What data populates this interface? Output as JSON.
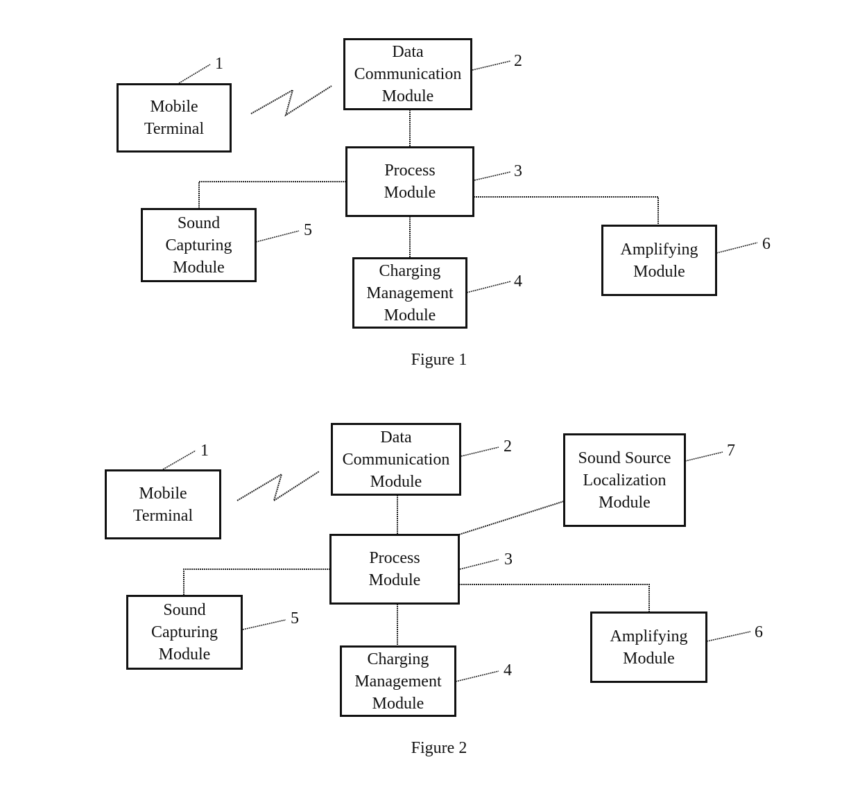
{
  "figures": [
    {
      "caption": "Figure 1",
      "modules": {
        "mobile_terminal": {
          "label": "Mobile\nTerminal",
          "ref": "1"
        },
        "data_communication": {
          "label": "Data\nCommunication\nModule",
          "ref": "2"
        },
        "process": {
          "label": "Process\nModule",
          "ref": "3"
        },
        "charging_management": {
          "label": "Charging\nManagement\nModule",
          "ref": "4"
        },
        "sound_capturing": {
          "label": "Sound\nCapturing\nModule",
          "ref": "5"
        },
        "amplifying": {
          "label": "Amplifying\nModule",
          "ref": "6"
        }
      },
      "connections": [
        [
          "mobile_terminal",
          "data_communication",
          "wireless"
        ],
        [
          "data_communication",
          "process",
          "wired"
        ],
        [
          "process",
          "sound_capturing",
          "wired"
        ],
        [
          "process",
          "charging_management",
          "wired"
        ],
        [
          "process",
          "amplifying",
          "wired"
        ]
      ]
    },
    {
      "caption": "Figure 2",
      "modules": {
        "mobile_terminal": {
          "label": "Mobile\nTerminal",
          "ref": "1"
        },
        "data_communication": {
          "label": "Data\nCommunication\nModule",
          "ref": "2"
        },
        "process": {
          "label": "Process\nModule",
          "ref": "3"
        },
        "charging_management": {
          "label": "Charging\nManagement\nModule",
          "ref": "4"
        },
        "sound_capturing": {
          "label": "Sound\nCapturing\nModule",
          "ref": "5"
        },
        "amplifying": {
          "label": "Amplifying\nModule",
          "ref": "6"
        },
        "sound_source_localization": {
          "label": "Sound Source\nLocalization\nModule",
          "ref": "7"
        }
      },
      "connections": [
        [
          "mobile_terminal",
          "data_communication",
          "wireless"
        ],
        [
          "data_communication",
          "process",
          "wired"
        ],
        [
          "process",
          "sound_capturing",
          "wired"
        ],
        [
          "process",
          "charging_management",
          "wired"
        ],
        [
          "process",
          "amplifying",
          "wired"
        ],
        [
          "process",
          "sound_source_localization",
          "wired"
        ]
      ]
    }
  ]
}
